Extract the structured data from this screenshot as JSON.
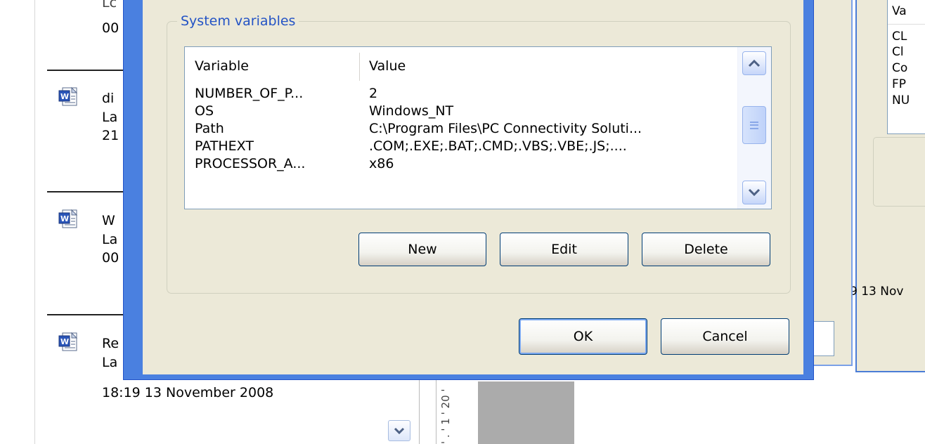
{
  "background_left": {
    "fragments": [
      "00",
      "di",
      "La",
      "21",
      "W",
      "La",
      "00",
      "Re",
      "La"
    ],
    "top_cut_fragment": "Lc",
    "last_timestamp": "18:19 13 November 2008"
  },
  "background_middle": {
    "ruler_text": "' . ' 1 ' 20 '"
  },
  "background_right": {
    "list_header": "Va",
    "list_items": [
      "CL",
      "Cl",
      "Co",
      "FP",
      "NU"
    ],
    "date_fragment": "9 13 Nov"
  },
  "dialog": {
    "system_variables": {
      "group_title": "System variables",
      "columns": {
        "variable": "Variable",
        "value": "Value"
      },
      "rows": [
        {
          "variable": "NUMBER_OF_P...",
          "value": "2"
        },
        {
          "variable": "OS",
          "value": "Windows_NT"
        },
        {
          "variable": "Path",
          "value": "C:\\Program Files\\PC Connectivity Soluti..."
        },
        {
          "variable": "PATHEXT",
          "value": ".COM;.EXE;.BAT;.CMD;.VBS;.VBE;.JS;...."
        },
        {
          "variable": "PROCESSOR_A...",
          "value": "x86"
        }
      ],
      "buttons": {
        "new": "New",
        "edit": "Edit",
        "delete": "Delete"
      }
    },
    "buttons": {
      "ok": "OK",
      "cancel": "Cancel"
    }
  },
  "colors": {
    "dialog_face": "#ece9d8",
    "group_title": "#2353c5",
    "window_frame": "#4a80e0"
  }
}
